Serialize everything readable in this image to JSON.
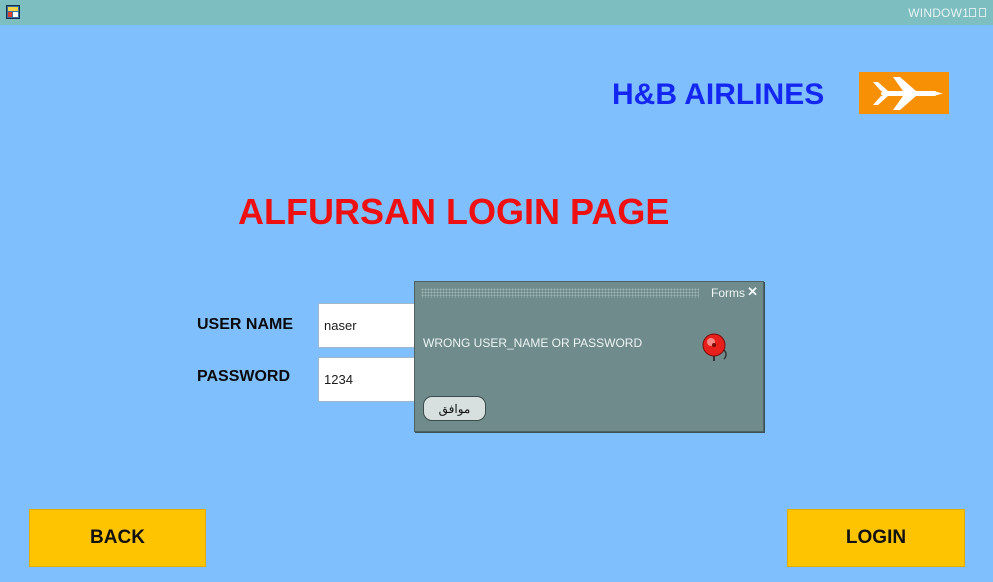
{
  "window": {
    "title": "WINDOW1",
    "app_icon": "oracle-forms-app-icon",
    "background_color": "#80bffe",
    "titlebar_color": "#7dbec0"
  },
  "brand": {
    "name": "H&B AIRLINES",
    "name_color": "#1427f2",
    "logo_icon": "airplane-icon",
    "logo_bg_color": "#f79005"
  },
  "page": {
    "title": "ALFURSAN LOGIN PAGE",
    "title_color": "#ee1010"
  },
  "form": {
    "username_label": "USER NAME",
    "username_value": "naser",
    "password_label": "PASSWORD",
    "password_value": "1234"
  },
  "buttons": {
    "back_label": "BACK",
    "login_label": "LOGIN",
    "color": "#fec301"
  },
  "dialog": {
    "title": "Forms",
    "close_glyph": "✕",
    "message": "WRONG USER_NAME OR PASSWORD",
    "icon": "alarm-bell-icon",
    "ok_label": "موافق",
    "bg_color": "#6f8b8c"
  }
}
